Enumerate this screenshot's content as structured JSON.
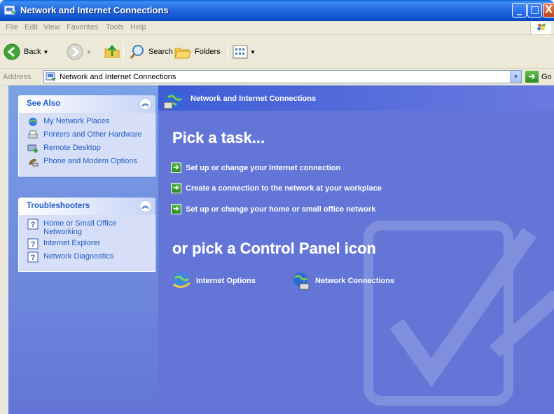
{
  "window": {
    "title": "Network and Internet Connections",
    "icon": "control-panel-icon",
    "minimize_glyph": "_",
    "maximize_glyph": "□",
    "close_glyph": "X"
  },
  "menubar": {
    "items": [
      "File",
      "Edit",
      "View",
      "Favorites",
      "Tools",
      "Help"
    ]
  },
  "toolbar": {
    "back_label": "Back",
    "search_label": "Search",
    "folders_label": "Folders"
  },
  "address": {
    "label": "Address",
    "value": "Network and Internet Connections",
    "go_label": "Go"
  },
  "left_pane": {
    "see_also": {
      "title": "See Also",
      "items": [
        {
          "label": "My Network Places",
          "icon": "network-places-icon"
        },
        {
          "label": "Printers and Other Hardware",
          "icon": "printer-icon"
        },
        {
          "label": "Remote Desktop",
          "icon": "remote-desktop-icon"
        },
        {
          "label": "Phone and Modem Options",
          "icon": "phone-modem-icon"
        }
      ]
    },
    "troubleshooters": {
      "title": "Troubleshooters",
      "items": [
        {
          "label": "Home or Small Office Networking",
          "icon": "help-icon"
        },
        {
          "label": "Internet Explorer",
          "icon": "help-icon"
        },
        {
          "label": "Network Diagnostics",
          "icon": "help-icon"
        }
      ]
    }
  },
  "main": {
    "header_title": "Network and Internet Connections",
    "pick_task_heading": "Pick a task...",
    "tasks": [
      "Set up or change your Internet connection",
      "Create a connection to the network at your workplace",
      "Set up or change your home or small office network"
    ],
    "pick_icon_heading": "or pick a Control Panel icon",
    "icons": [
      {
        "label": "Internet Options",
        "icon": "internet-options-icon"
      },
      {
        "label": "Network Connections",
        "icon": "network-connections-icon"
      }
    ]
  },
  "colors": {
    "titlebar": "#0a5fd8",
    "right_pane": "#6375d6",
    "pane_link": "#215dc6",
    "task_arrow": "#2e8a22"
  }
}
